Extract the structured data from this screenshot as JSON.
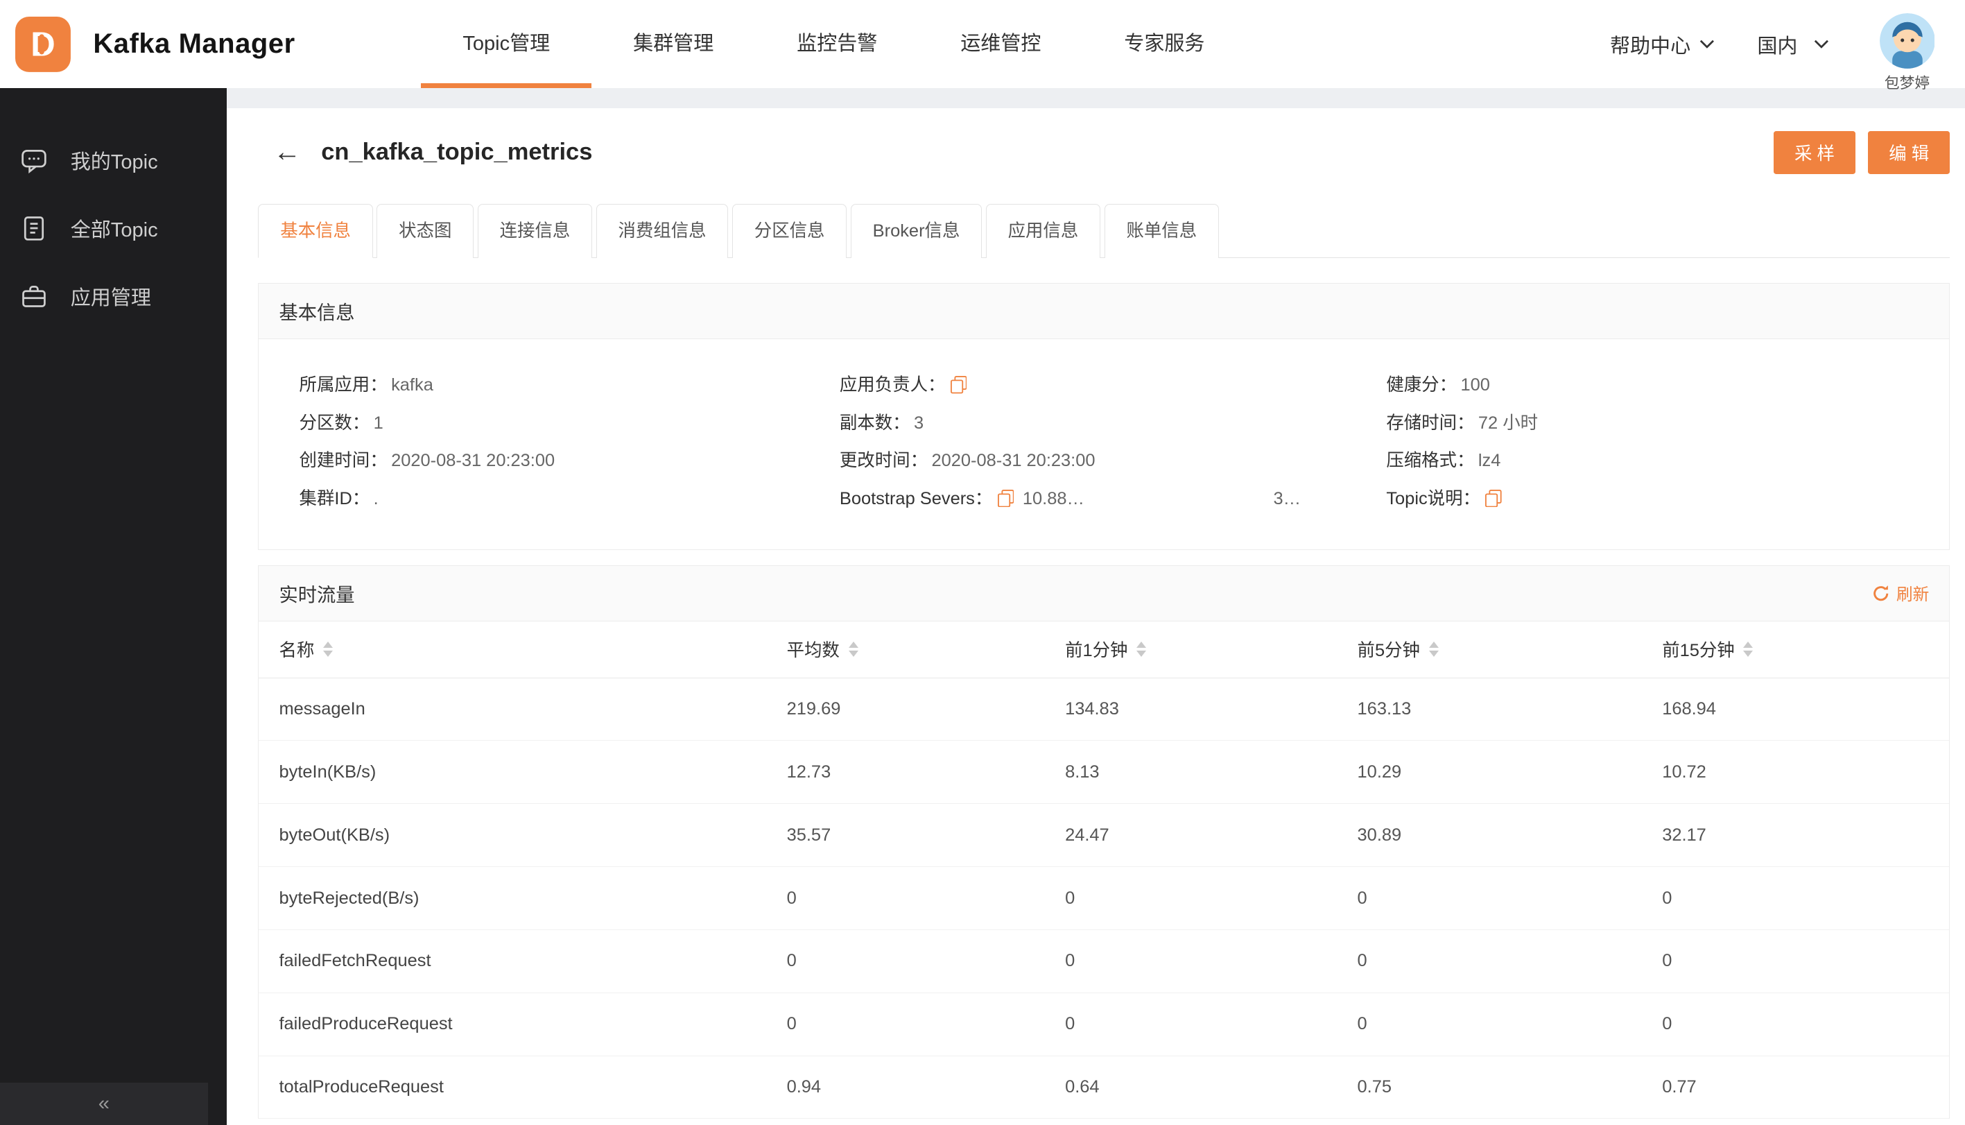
{
  "colors": {
    "accent": "#f0823f"
  },
  "icons": {
    "back": "←",
    "collapse": "«"
  },
  "topbar": {
    "brand": "Kafka Manager",
    "nav": [
      {
        "label": "Topic管理",
        "active": true
      },
      {
        "label": "集群管理"
      },
      {
        "label": "监控告警"
      },
      {
        "label": "运维管控"
      },
      {
        "label": "专家服务"
      }
    ],
    "help": "帮助中心",
    "region": "国内",
    "user": "包梦婷"
  },
  "sidebar": {
    "items": [
      {
        "label": "我的Topic"
      },
      {
        "label": "全部Topic"
      },
      {
        "label": "应用管理"
      }
    ]
  },
  "page": {
    "title": "cn_kafka_topic_metrics",
    "actions": [
      {
        "label": "采 样"
      },
      {
        "label": "编 辑"
      }
    ],
    "tabs": [
      {
        "label": "基本信息",
        "active": true
      },
      {
        "label": "状态图"
      },
      {
        "label": "连接信息"
      },
      {
        "label": "消费组信息"
      },
      {
        "label": "分区信息"
      },
      {
        "label": "Broker信息"
      },
      {
        "label": "应用信息"
      },
      {
        "label": "账单信息"
      }
    ]
  },
  "basic_info": {
    "title": "基本信息",
    "fields": [
      {
        "label": "所属应用：",
        "value": "kafka"
      },
      {
        "label": "应用负责人：",
        "value": "",
        "copy": true
      },
      {
        "label": "健康分：",
        "value": "100"
      },
      {
        "label": "分区数：",
        "value": "1"
      },
      {
        "label": "副本数：",
        "value": "3"
      },
      {
        "label": "存储时间：",
        "value": "72 小时"
      },
      {
        "label": "创建时间：",
        "value": "2020-08-31 20:23:00"
      },
      {
        "label": "更改时间：",
        "value": "2020-08-31 20:23:00"
      },
      {
        "label": "压缩格式：",
        "value": "lz4"
      },
      {
        "label": "集群ID：",
        "value": "."
      },
      {
        "label": "Bootstrap Severs：",
        "value": "10.88…",
        "value2": "3…",
        "copy": true
      },
      {
        "label": "Topic说明：",
        "value": "",
        "copy": true
      }
    ]
  },
  "realtime": {
    "title": "实时流量",
    "refresh": "刷新",
    "columns": [
      "名称",
      "平均数",
      "前1分钟",
      "前5分钟",
      "前15分钟"
    ],
    "rows": [
      [
        "messageIn",
        "219.69",
        "134.83",
        "163.13",
        "168.94"
      ],
      [
        "byteIn(KB/s)",
        "12.73",
        "8.13",
        "10.29",
        "10.72"
      ],
      [
        "byteOut(KB/s)",
        "35.57",
        "24.47",
        "30.89",
        "32.17"
      ],
      [
        "byteRejected(B/s)",
        "0",
        "0",
        "0",
        "0"
      ],
      [
        "failedFetchRequest",
        "0",
        "0",
        "0",
        "0"
      ],
      [
        "failedProduceRequest",
        "0",
        "0",
        "0",
        "0"
      ],
      [
        "totalProduceRequest",
        "0.94",
        "0.64",
        "0.75",
        "0.77"
      ]
    ]
  }
}
